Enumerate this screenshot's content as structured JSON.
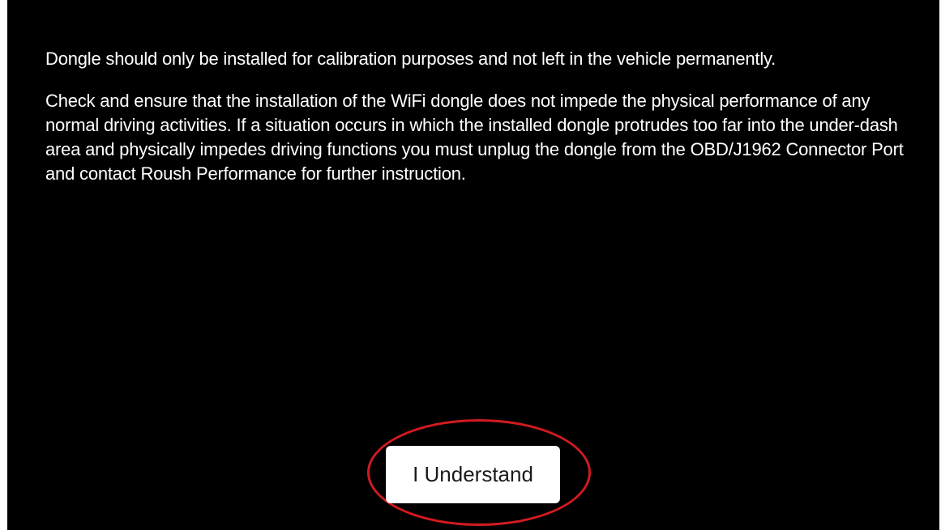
{
  "notice": {
    "paragraph_1": "Dongle should only be installed for calibration purposes and not left in the vehicle permanently.",
    "paragraph_2": "Check and ensure that the installation of the WiFi dongle does not impede the physical performance of any normal driving activities. If a situation occurs in which the installed dongle protrudes too far into the under-dash area and physically impedes driving functions you must unplug the dongle from the OBD/J1962 Connector Port and contact Roush Performance for further instruction."
  },
  "actions": {
    "understand_label": "I Understand"
  },
  "colors": {
    "background": "#000000",
    "text": "#ffffff",
    "button_background": "#ffffff",
    "highlight_ring": "#d21a1f"
  }
}
